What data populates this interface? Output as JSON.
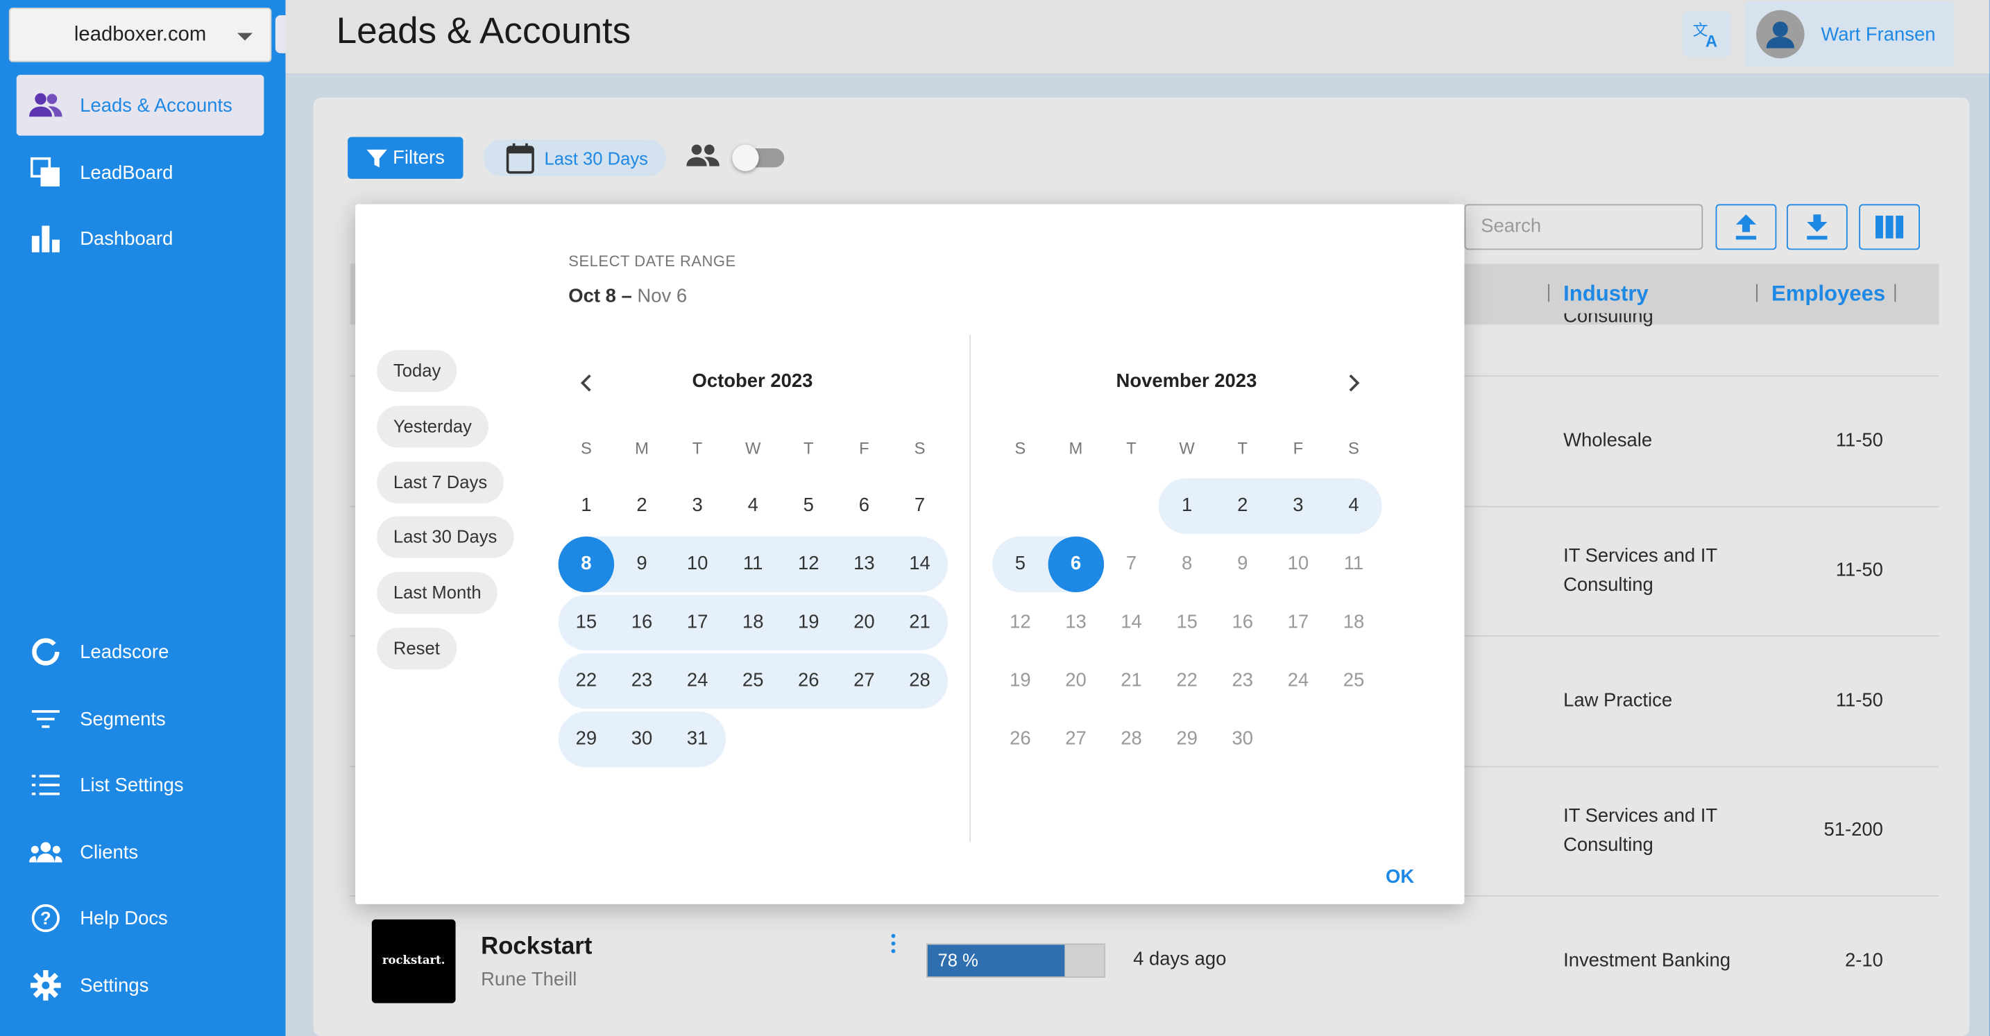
{
  "sidebar": {
    "domain": "leadboxer.com",
    "top_items": [
      {
        "label": "Leads & Accounts",
        "icon": "people-icon",
        "active": true
      },
      {
        "label": "LeadBoard",
        "icon": "copy-icon"
      },
      {
        "label": "Dashboard",
        "icon": "bar-chart-icon"
      }
    ],
    "bottom_items": [
      {
        "label": "Leadscore",
        "icon": "ring-icon"
      },
      {
        "label": "Segments",
        "icon": "filter-lines-icon"
      },
      {
        "label": "List Settings",
        "icon": "list-icon"
      },
      {
        "label": "Clients",
        "icon": "group-icon"
      },
      {
        "label": "Help Docs",
        "icon": "help-icon"
      },
      {
        "label": "Settings",
        "icon": "gear-icon"
      }
    ]
  },
  "header": {
    "title": "Leads & Accounts",
    "user_name": "Wart Fransen"
  },
  "toolbar": {
    "filters_label": "Filters",
    "date_chip_label": "Last 30 Days",
    "search_placeholder": "Search"
  },
  "table": {
    "columns": [
      "Industry",
      "Employees"
    ],
    "rows": [
      {
        "industry": "Consulting",
        "employees": ""
      },
      {
        "industry": "Wholesale",
        "employees": "11-50"
      },
      {
        "industry": "IT Services and IT Consulting",
        "employees": "11-50"
      },
      {
        "industry": "Law Practice",
        "employees": "11-50"
      },
      {
        "industry": "IT Services and IT Consulting",
        "employees": "51-200"
      }
    ],
    "last_row": {
      "logo_text": "rockstart.",
      "company": "Rockstart",
      "person": "Rune Theill",
      "score_label": "78 %",
      "score_fraction": 0.78,
      "last_seen": "4 days ago",
      "industry": "Investment Banking",
      "employees": "2-10"
    }
  },
  "date_dialog": {
    "label": "SELECT DATE RANGE",
    "range_start": "Oct 8",
    "range_sep": " – ",
    "range_end": "Nov 6",
    "presets": [
      "Today",
      "Yesterday",
      "Last 7 Days",
      "Last 30 Days",
      "Last Month",
      "Reset"
    ],
    "weekdays": [
      "S",
      "M",
      "T",
      "W",
      "T",
      "F",
      "S"
    ],
    "months": [
      {
        "title": "October 2023",
        "first_weekday": 0,
        "days": 31,
        "selected": [
          8
        ],
        "in_range_from": 8,
        "in_range_to": 31,
        "muted_from": 99
      },
      {
        "title": "November 2023",
        "first_weekday": 3,
        "days": 30,
        "selected": [
          6
        ],
        "in_range_from": 1,
        "in_range_to": 6,
        "muted_from": 7
      }
    ],
    "ok_label": "OK"
  },
  "colors": {
    "sidebar": "#1e88e5",
    "accent": "#1e88e5",
    "range_band": "#e6f0fa",
    "score_fill": "#2f6faf"
  }
}
